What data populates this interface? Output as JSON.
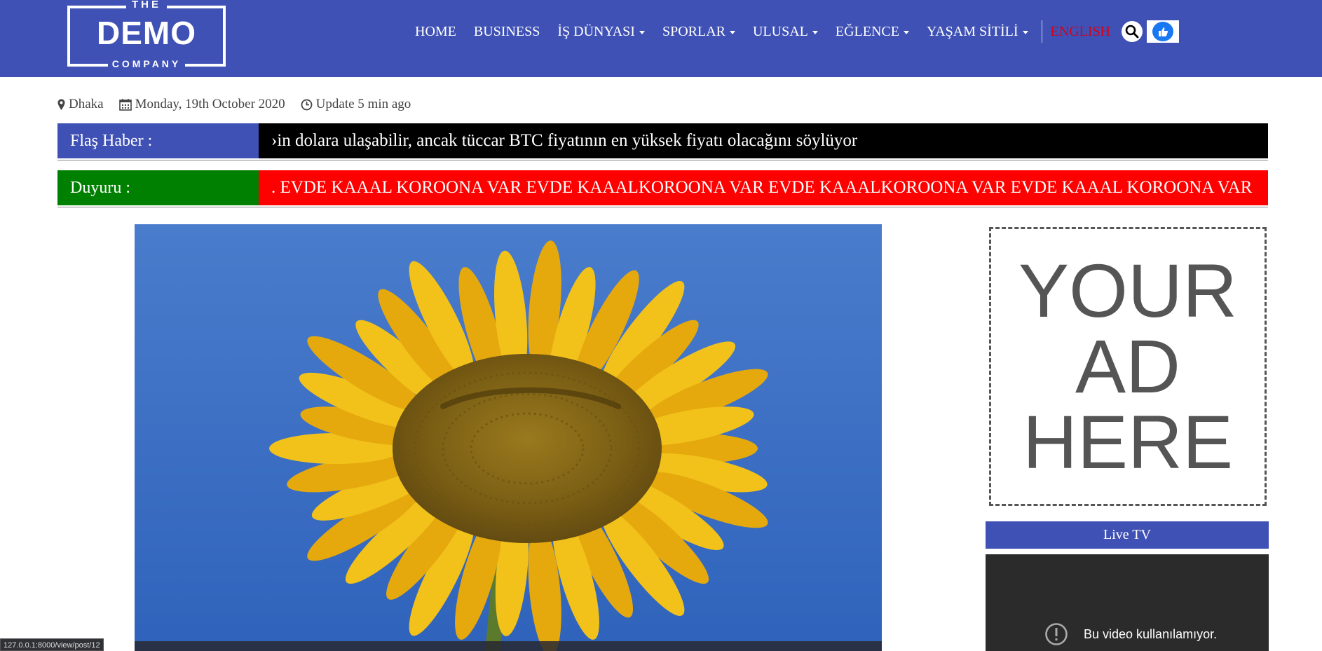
{
  "logo": {
    "the": "THE",
    "demo": "DEMO",
    "company": "COMPANY"
  },
  "nav": {
    "home": "HOME",
    "business": "BUSINESS",
    "is_dunyasi": "İŞ DÜNYASI",
    "sporlar": "SPORLAR",
    "ulusal": "ULUSAL",
    "eglence": "EĞLENCE",
    "yasam": "YAŞAM SİTİLİ",
    "english": "ENGLISH",
    "english_color": "#d0021b"
  },
  "info": {
    "location": "Dhaka",
    "date": "Monday, 19th October 2020",
    "update": "Update 5 min ago"
  },
  "breaking": {
    "label": "Flaş Haber :",
    "text": "›in dolara ulaşabilir, ancak tüccar BTC fiyatının en yüksek fiyatı olacağını söylüyor",
    "label_bg": "#3f51b5",
    "body_bg": "#000000"
  },
  "announcement": {
    "label": "Duyuru :",
    "text": ". EVDE KAAAL KOROONA VAR EVDE KAAALKOROONA VAR EVDE KAAALKOROONA VAR EVDE KAAAL KOROONA VAR",
    "label_bg": "#008000",
    "body_bg": "#ff0000"
  },
  "ad": {
    "line1": "YOUR",
    "line2": "AD",
    "line3": "HERE"
  },
  "live_tv": {
    "title": "Live TV",
    "video_message": "Bu video kullanılamıyor."
  },
  "status_bar": "127.0.0.1:8000/view/post/12",
  "colors": {
    "header": "#3f51b5",
    "accent": "#3f51b5"
  }
}
